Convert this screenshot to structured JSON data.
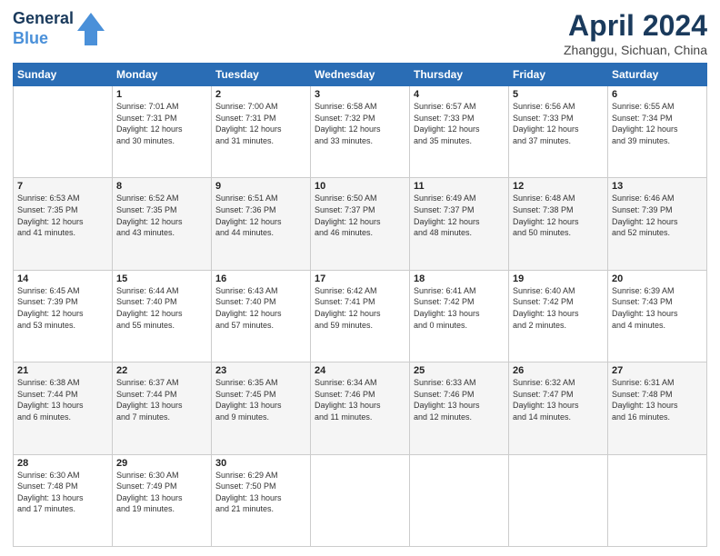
{
  "header": {
    "logo_line1": "General",
    "logo_line2": "Blue",
    "title": "April 2024",
    "subtitle": "Zhanggu, Sichuan, China"
  },
  "weekdays": [
    "Sunday",
    "Monday",
    "Tuesday",
    "Wednesday",
    "Thursday",
    "Friday",
    "Saturday"
  ],
  "weeks": [
    [
      {
        "day": "",
        "info": ""
      },
      {
        "day": "1",
        "info": "Sunrise: 7:01 AM\nSunset: 7:31 PM\nDaylight: 12 hours\nand 30 minutes."
      },
      {
        "day": "2",
        "info": "Sunrise: 7:00 AM\nSunset: 7:31 PM\nDaylight: 12 hours\nand 31 minutes."
      },
      {
        "day": "3",
        "info": "Sunrise: 6:58 AM\nSunset: 7:32 PM\nDaylight: 12 hours\nand 33 minutes."
      },
      {
        "day": "4",
        "info": "Sunrise: 6:57 AM\nSunset: 7:33 PM\nDaylight: 12 hours\nand 35 minutes."
      },
      {
        "day": "5",
        "info": "Sunrise: 6:56 AM\nSunset: 7:33 PM\nDaylight: 12 hours\nand 37 minutes."
      },
      {
        "day": "6",
        "info": "Sunrise: 6:55 AM\nSunset: 7:34 PM\nDaylight: 12 hours\nand 39 minutes."
      }
    ],
    [
      {
        "day": "7",
        "info": "Sunrise: 6:53 AM\nSunset: 7:35 PM\nDaylight: 12 hours\nand 41 minutes."
      },
      {
        "day": "8",
        "info": "Sunrise: 6:52 AM\nSunset: 7:35 PM\nDaylight: 12 hours\nand 43 minutes."
      },
      {
        "day": "9",
        "info": "Sunrise: 6:51 AM\nSunset: 7:36 PM\nDaylight: 12 hours\nand 44 minutes."
      },
      {
        "day": "10",
        "info": "Sunrise: 6:50 AM\nSunset: 7:37 PM\nDaylight: 12 hours\nand 46 minutes."
      },
      {
        "day": "11",
        "info": "Sunrise: 6:49 AM\nSunset: 7:37 PM\nDaylight: 12 hours\nand 48 minutes."
      },
      {
        "day": "12",
        "info": "Sunrise: 6:48 AM\nSunset: 7:38 PM\nDaylight: 12 hours\nand 50 minutes."
      },
      {
        "day": "13",
        "info": "Sunrise: 6:46 AM\nSunset: 7:39 PM\nDaylight: 12 hours\nand 52 minutes."
      }
    ],
    [
      {
        "day": "14",
        "info": "Sunrise: 6:45 AM\nSunset: 7:39 PM\nDaylight: 12 hours\nand 53 minutes."
      },
      {
        "day": "15",
        "info": "Sunrise: 6:44 AM\nSunset: 7:40 PM\nDaylight: 12 hours\nand 55 minutes."
      },
      {
        "day": "16",
        "info": "Sunrise: 6:43 AM\nSunset: 7:40 PM\nDaylight: 12 hours\nand 57 minutes."
      },
      {
        "day": "17",
        "info": "Sunrise: 6:42 AM\nSunset: 7:41 PM\nDaylight: 12 hours\nand 59 minutes."
      },
      {
        "day": "18",
        "info": "Sunrise: 6:41 AM\nSunset: 7:42 PM\nDaylight: 13 hours\nand 0 minutes."
      },
      {
        "day": "19",
        "info": "Sunrise: 6:40 AM\nSunset: 7:42 PM\nDaylight: 13 hours\nand 2 minutes."
      },
      {
        "day": "20",
        "info": "Sunrise: 6:39 AM\nSunset: 7:43 PM\nDaylight: 13 hours\nand 4 minutes."
      }
    ],
    [
      {
        "day": "21",
        "info": "Sunrise: 6:38 AM\nSunset: 7:44 PM\nDaylight: 13 hours\nand 6 minutes."
      },
      {
        "day": "22",
        "info": "Sunrise: 6:37 AM\nSunset: 7:44 PM\nDaylight: 13 hours\nand 7 minutes."
      },
      {
        "day": "23",
        "info": "Sunrise: 6:35 AM\nSunset: 7:45 PM\nDaylight: 13 hours\nand 9 minutes."
      },
      {
        "day": "24",
        "info": "Sunrise: 6:34 AM\nSunset: 7:46 PM\nDaylight: 13 hours\nand 11 minutes."
      },
      {
        "day": "25",
        "info": "Sunrise: 6:33 AM\nSunset: 7:46 PM\nDaylight: 13 hours\nand 12 minutes."
      },
      {
        "day": "26",
        "info": "Sunrise: 6:32 AM\nSunset: 7:47 PM\nDaylight: 13 hours\nand 14 minutes."
      },
      {
        "day": "27",
        "info": "Sunrise: 6:31 AM\nSunset: 7:48 PM\nDaylight: 13 hours\nand 16 minutes."
      }
    ],
    [
      {
        "day": "28",
        "info": "Sunrise: 6:30 AM\nSunset: 7:48 PM\nDaylight: 13 hours\nand 17 minutes."
      },
      {
        "day": "29",
        "info": "Sunrise: 6:30 AM\nSunset: 7:49 PM\nDaylight: 13 hours\nand 19 minutes."
      },
      {
        "day": "30",
        "info": "Sunrise: 6:29 AM\nSunset: 7:50 PM\nDaylight: 13 hours\nand 21 minutes."
      },
      {
        "day": "",
        "info": ""
      },
      {
        "day": "",
        "info": ""
      },
      {
        "day": "",
        "info": ""
      },
      {
        "day": "",
        "info": ""
      }
    ]
  ]
}
